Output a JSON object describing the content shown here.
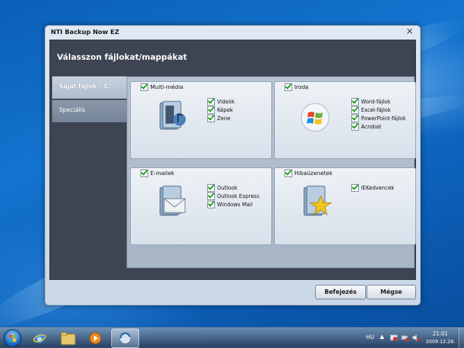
{
  "window": {
    "title": "NTI Backup Now EZ",
    "close_label": "×"
  },
  "header": {
    "title": "Válasszon fájlokat/mappákat"
  },
  "sidebar": {
    "items": [
      {
        "label": "Saját fájlok – C:",
        "active": true
      },
      {
        "label": "Speciális",
        "active": false
      }
    ]
  },
  "groups": [
    {
      "label": "Multi-média",
      "icon": "media-folder-icon",
      "items": [
        "Videók",
        "Képek",
        "Zene"
      ]
    },
    {
      "label": "Iroda",
      "icon": "windows-logo-icon",
      "items": [
        "Word-fájlok",
        "Excel-fájlok",
        "PowerPoint-fájlok",
        "Acrobat"
      ]
    },
    {
      "label": "E-mailek",
      "icon": "mail-folder-icon",
      "items": [
        "Outlook",
        "Outlook Express",
        "Windows Mail"
      ]
    },
    {
      "label": "Hibaüzenetek",
      "icon": "favorites-folder-icon",
      "items": [
        "IEKedvencek"
      ]
    }
  ],
  "buttons": {
    "finish": "Befejezés",
    "cancel": "Mégse"
  },
  "taskbar": {
    "language": "HU",
    "time": "21:01",
    "date": "2009.12.28.",
    "pinned": [
      "start-orb-icon",
      "ie-icon",
      "explorer-icon",
      "media-player-icon",
      "nti-backup-icon"
    ]
  },
  "colors": {
    "checkmark": "#1d9c1d",
    "content_bg": "#3d4452",
    "desktop": "#0d63bd"
  }
}
